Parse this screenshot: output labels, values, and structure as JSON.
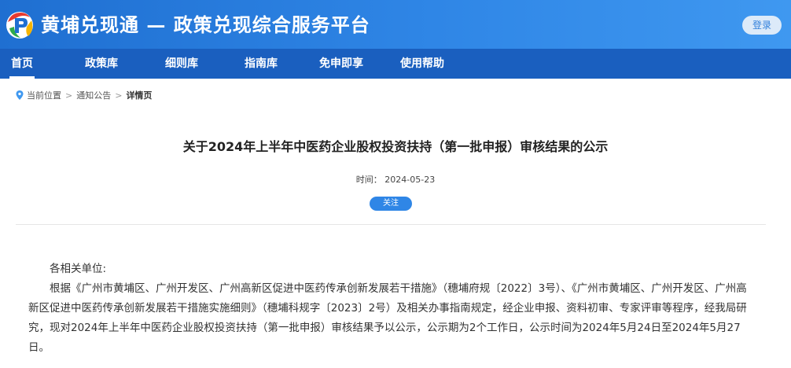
{
  "header": {
    "site_title": "黄埔兑现通 — 政策兑现综合服务平台",
    "login_label": "登录",
    "colors": {
      "header_start": "#1f6fd1",
      "header_end": "#3f98f0",
      "nav": "#1a5fbf"
    }
  },
  "nav": {
    "items": [
      {
        "label": "首页",
        "active": true
      },
      {
        "label": "政策库"
      },
      {
        "label": "细则库"
      },
      {
        "label": "指南库"
      },
      {
        "label": "免申即享"
      },
      {
        "label": "使用帮助"
      }
    ]
  },
  "breadcrumb": {
    "prefix": "当前位置",
    "items": [
      "通知公告",
      "详情页"
    ],
    "separator": ">"
  },
  "article": {
    "title": "关于2024年上半年中医药企业股权投资扶持（第一批申报）审核结果的公示",
    "date_label": "时间：",
    "date": "2024-05-23",
    "follow_label": "关注",
    "salutation": "各相关单位:",
    "body": "根据《广州市黄埔区、广州开发区、广州高新区促进中医药传承创新发展若干措施》（穗埔府规〔2022〕3号）、《广州市黄埔区、广州开发区、广州高新区促进中医药传承创新发展若干措施实施细则》（穗埔科规字〔2023〕2号）及相关办事指南规定，经企业申报、资料初审、专家评审等程序，经我局研究，现对2024年上半年中医药企业股权投资扶持（第一批申报）审核结果予以公示，公示期为2个工作日，公示时间为2024年5月24日至2024年5月27日。"
  }
}
